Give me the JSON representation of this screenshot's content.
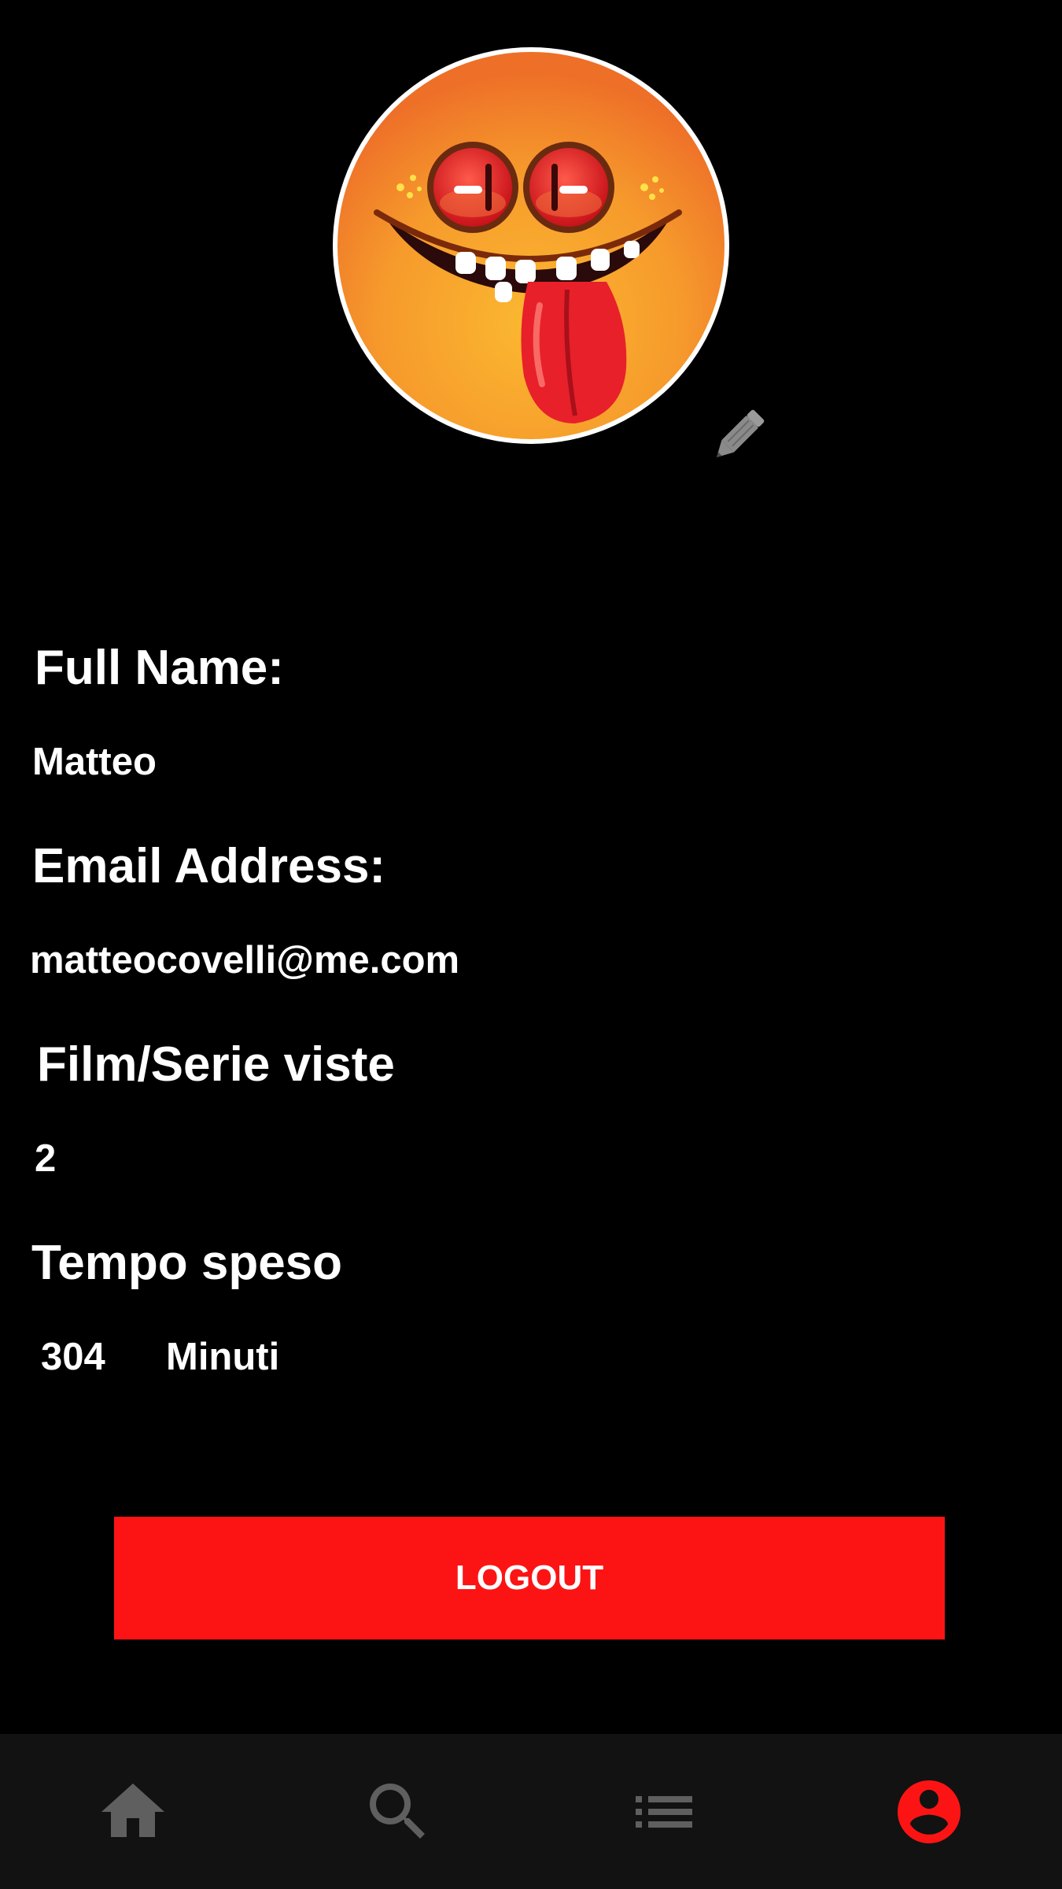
{
  "profile": {
    "avatar_icon": "smiley-tongue-avatar",
    "edit_icon": "pencil-icon"
  },
  "fields": {
    "full_name_label": "Full Name:",
    "full_name_value": "Matteo",
    "email_label": "Email Address:",
    "email_value": "matteocovelli@me.com",
    "watched_label": "Film/Serie viste",
    "watched_value": "2",
    "time_label": "Tempo speso",
    "time_value": "304",
    "time_unit": "Minuti"
  },
  "actions": {
    "logout_label": "LOGOUT"
  },
  "nav": {
    "items": [
      {
        "icon": "home-icon",
        "active": false
      },
      {
        "icon": "search-icon",
        "active": false
      },
      {
        "icon": "list-icon",
        "active": false
      },
      {
        "icon": "account-icon",
        "active": true
      }
    ]
  },
  "colors": {
    "background": "#000000",
    "accent": "#fc1414",
    "nav_background": "#121212",
    "nav_inactive": "#5f5f5f",
    "text": "#ffffff"
  }
}
